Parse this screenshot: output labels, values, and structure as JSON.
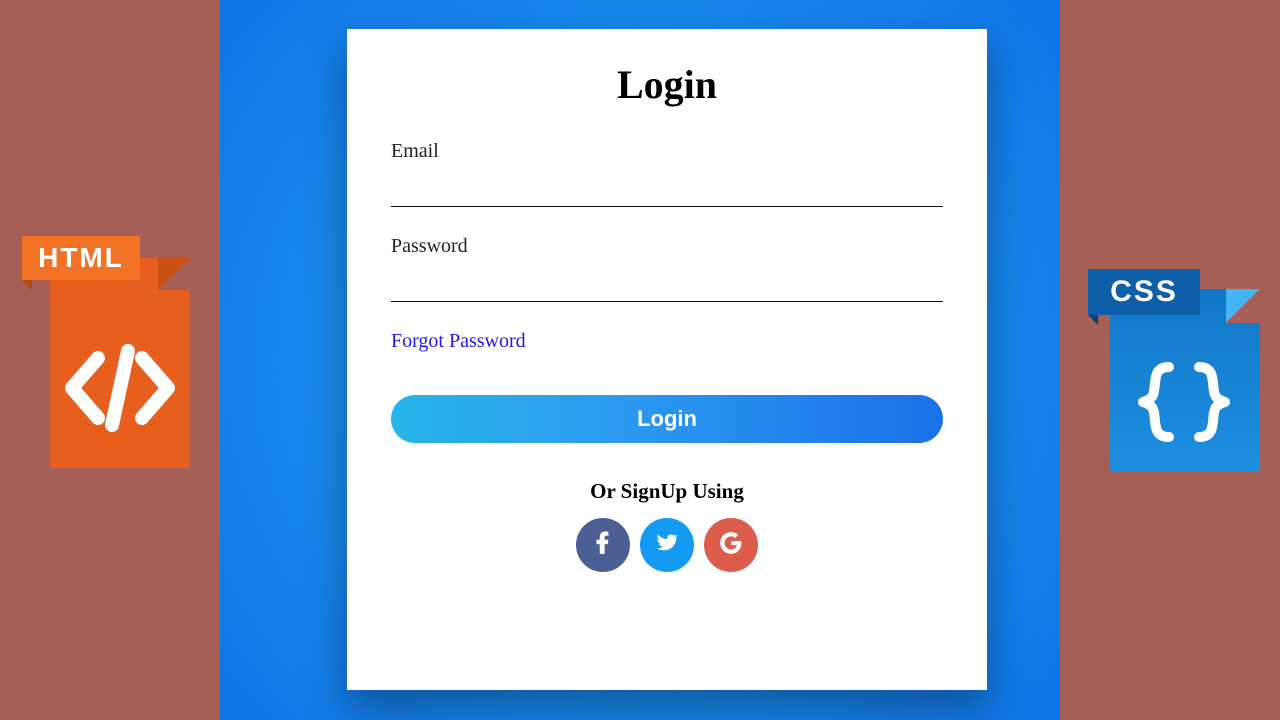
{
  "form": {
    "title": "Login",
    "email_label": "Email",
    "email_value": "",
    "password_label": "Password",
    "password_value": "",
    "forgot_label": "Forgot Password",
    "submit_label": "Login",
    "alt_signup_label": "Or SignUp Using"
  },
  "socials": {
    "facebook": "f",
    "twitter": "twitter",
    "google": "G"
  },
  "decor": {
    "html_badge": "HTML",
    "css_badge": "CSS"
  },
  "colors": {
    "page_bg": "#a65f56",
    "stage_inner": "#27a9f5",
    "stage_outer": "#0f73e6",
    "link": "#2319e0",
    "btn_grad_start": "#27b5e8",
    "btn_grad_end": "#1971e8",
    "facebook": "#4b5f94",
    "twitter": "#149bf1",
    "google": "#dc5d4c",
    "html_icon": "#e65f1f",
    "css_icon": "#1276c8"
  }
}
